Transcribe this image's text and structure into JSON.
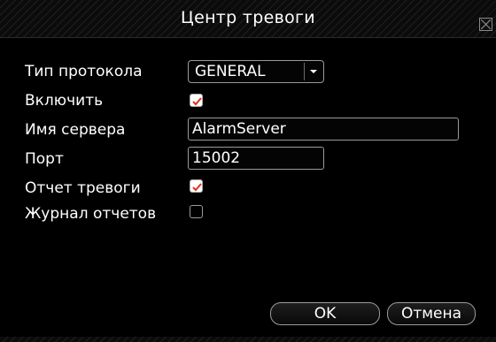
{
  "window": {
    "title": "Центр тревоги"
  },
  "form": {
    "protocol_label": "Тип протокола",
    "protocol_value": "GENERAL",
    "enable_label": "Включить",
    "enable_checked": true,
    "server_name_label": "Имя сервера",
    "server_name_value": "AlarmServer",
    "port_label": "Порт",
    "port_value": "15002",
    "alarm_report_label": "Отчет тревоги",
    "alarm_report_checked": true,
    "log_report_label": "Журнал отчетов",
    "log_report_checked": false
  },
  "buttons": {
    "ok_label": "OK",
    "cancel_label": "Отмена"
  },
  "colors": {
    "checkmark": "#e0301e",
    "text": "#ffffff",
    "background": "#000000"
  },
  "icons": {
    "close": "close-icon",
    "dropdown": "chevron-down-icon",
    "check": "checkmark-icon"
  }
}
